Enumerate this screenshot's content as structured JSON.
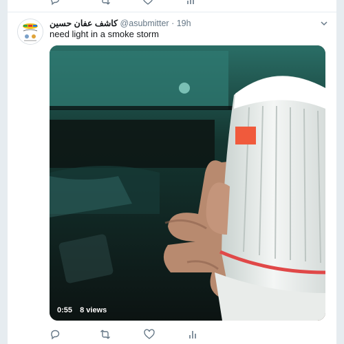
{
  "tweet": {
    "display_name": "كاشف عفان حسين",
    "handle": "@asubmitter",
    "separator": "·",
    "time": "19h",
    "text": "need light in a smoke storm",
    "video": {
      "duration": "0:55",
      "views": "8 views"
    }
  },
  "icons": {
    "reply": "reply-icon",
    "retweet": "retweet-icon",
    "like": "heart-icon",
    "analytics": "analytics-icon",
    "more": "chevron-down-icon"
  },
  "colors": {
    "background": "#e6ecf0",
    "text_primary": "#14171a",
    "text_secondary": "#657786"
  }
}
